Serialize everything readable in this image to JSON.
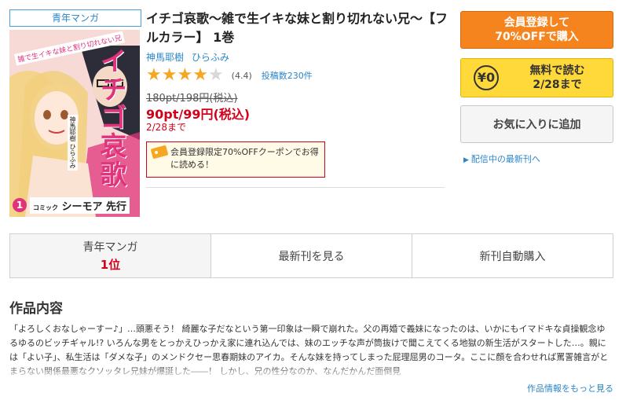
{
  "genre_tag": "青年マンガ",
  "cover": {
    "title": "イチゴ哀歌",
    "subtitle": "雑で生イキな妹と割り切れない兄",
    "author": "神馬耶樹 ひらふみ",
    "volume": "1",
    "label_small": "コミック",
    "label": "シーモア 先行"
  },
  "product": {
    "title": "イチゴ哀歌～雑で生イキな妹と割り切れない兄～【フルカラー】 1巻",
    "authors": [
      "神馬耶樹",
      "ひらふみ"
    ],
    "rating": 4.4,
    "rating_text": "(4.4)",
    "review_count": "投稿数230件",
    "old_price": "180pt/198円(税込)",
    "sale_price": "90pt/99円(税込)",
    "deadline": "2/28まで",
    "coupon_text": "会員登録限定70%OFFクーポンでお得に読める！"
  },
  "buttons": {
    "register_line1": "会員登録して",
    "register_line2": "70%OFFで購入",
    "free_badge": "¥0",
    "free_line1": "無料で読む",
    "free_line2": "2/28まで",
    "favorite": "お気に入りに追加",
    "latest_link": "配信中の最新刊へ"
  },
  "stats": {
    "rank_category": "青年マンガ",
    "rank_value": "1位",
    "latest": "最新刊を見る",
    "auto_buy": "新刊自動購入"
  },
  "section": {
    "title": "作品内容",
    "description": "「よろしくおなしゃーすー♪」…頭悪そう！ 綺麗な子だなという第一印象は一瞬で崩れた。父の再婚で義妹になったのは、いかにもイマドキな貞操観念ゆるゆるのビッチギャル!? いろんな男をとっかえひっかえ家に連れ込んでは、妹のエッチな声が筒抜けで聞こえてくる地獄の新生活がスタートした…。親には「よい子」、私生活は「ダメな子」のメンドクセー思春期妹のアイカ。そんな妹を持ってしまった屁理屈男のコータ。ここに顔を合わせれば罵詈雑言がとまらない関係最悪なクソッタレ兄妹が爆誕した――！ しかし、兄の性分なのか、なんだかんだ面倒見",
    "more_link": "作品情報をもっと見る"
  },
  "colors": {
    "accent_orange": "#f5841f",
    "accent_yellow": "#ffd93a",
    "price_red": "#d0021b",
    "link_blue": "#2a86c8",
    "star": "#f5a623"
  }
}
